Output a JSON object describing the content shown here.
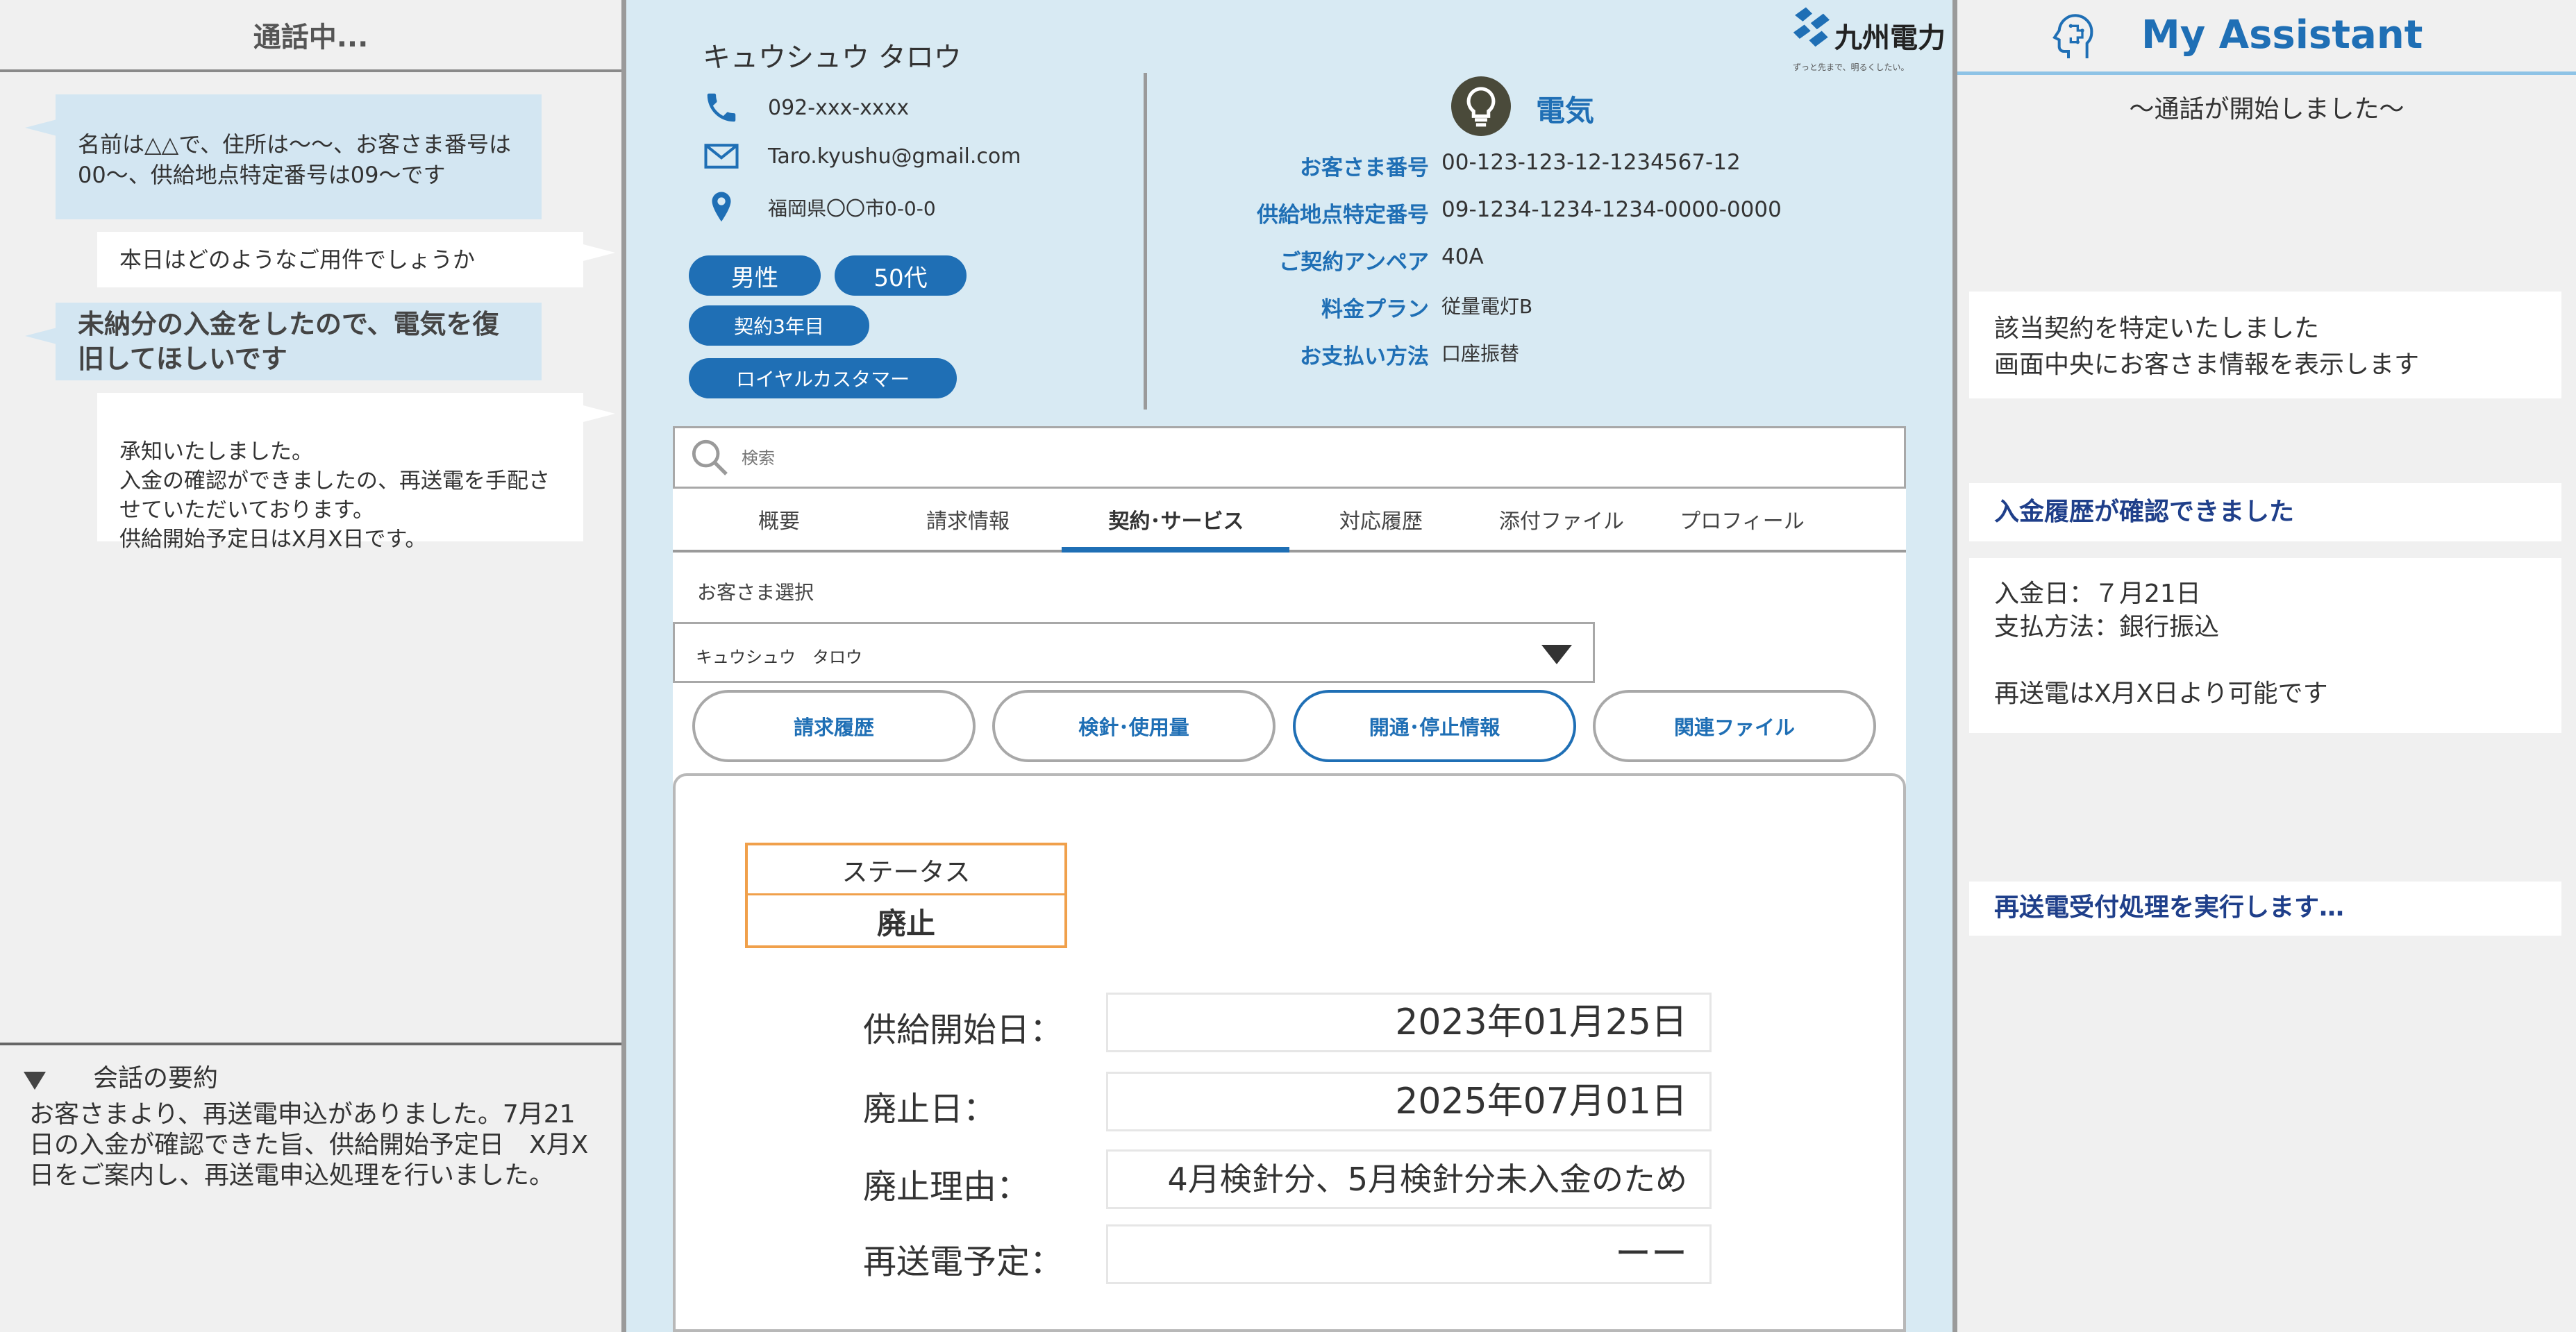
{
  "left": {
    "header": "通話中...",
    "messages": [
      {
        "who": "customer",
        "text": "名前は△△で、住所は～～、お客さま番号は00～、供給地点特定番号は09～です"
      },
      {
        "who": "operator",
        "text": "本日はどのようなご用件でしょうか"
      },
      {
        "who": "customer",
        "text": "未納分の入金をしたので、電気を復旧してほしいです"
      },
      {
        "who": "operator",
        "text": "承知いたしました。\n入金の確認ができましたの、再送電を手配させていただいております。\n供給開始予定日はX月X日です。"
      }
    ],
    "summary_title": "会話の要約",
    "summary_text": "お客さまより、再送電申込がありました。7月21日の入金が確認できた旨、供給開始予定日　X月X日をご案内し、再送電申込処理を行いました。"
  },
  "center": {
    "customer_name": "キュウシュウ タロウ",
    "phone": "092-xxx-xxxx",
    "email": "Taro.kyushu@gmail.com",
    "address": "福岡県〇〇市0-0-0",
    "tags": {
      "gender": "男性",
      "age": "50代",
      "contract_years": "契約3年目",
      "loyal": "ロイヤルカスタマー"
    },
    "logo_text": "九州電力",
    "logo_tagline": "ずっと先まで、明るくしたい。",
    "service_title": "電気",
    "info": [
      {
        "label": "お客さま番号",
        "value": "00-123-123-12-1234567-12"
      },
      {
        "label": "供給地点特定番号",
        "value": "09-1234-1234-1234-0000-0000"
      },
      {
        "label": "ご契約アンペア",
        "value": "40A"
      },
      {
        "label": "料金プラン",
        "value": "従量電灯B"
      },
      {
        "label": "お支払い方法",
        "value": "口座振替"
      }
    ],
    "search_placeholder": "検索",
    "tabs": [
      "概要",
      "請求情報",
      "契約･サービス",
      "対応履歴",
      "添付ファイル",
      "プロフィール"
    ],
    "active_tab": "契約･サービス",
    "customer_select_label": "お客さま選択",
    "customer_select_value": "キュウシュウ　タロウ",
    "function_buttons": [
      "請求履歴",
      "検針･使用量",
      "開通･停止情報",
      "関連ファイル"
    ],
    "active_function": "開通･停止情報",
    "status_label": "ステータス",
    "status_value": "廃止",
    "details": [
      {
        "label": "供給開始日：",
        "value": "2023年01月25日"
      },
      {
        "label": "廃止日：",
        "value": "2025年07月01日"
      },
      {
        "label": "廃止理由：",
        "value": "4月検針分、5月検針分未入金のため"
      },
      {
        "label": "再送電予定：",
        "value": "ーー"
      }
    ]
  },
  "right": {
    "title": "My Assistant",
    "started": "～通話が開始しました～",
    "card1": "該当契約を特定いたしました\n画面中央にお客さま情報を表示します",
    "card2": "入金履歴が確認できました",
    "card3": "入金日：７月21日\n支払方法：銀行振込\n\n再送電はX月X日より可能です",
    "card4": "再送電受付処理を実行します…"
  },
  "colors": {
    "accent": "#1f6fb5",
    "status_border": "#f0a04b",
    "center_bg": "#d8eaf3",
    "bubble_in": "#d3e6f2"
  }
}
